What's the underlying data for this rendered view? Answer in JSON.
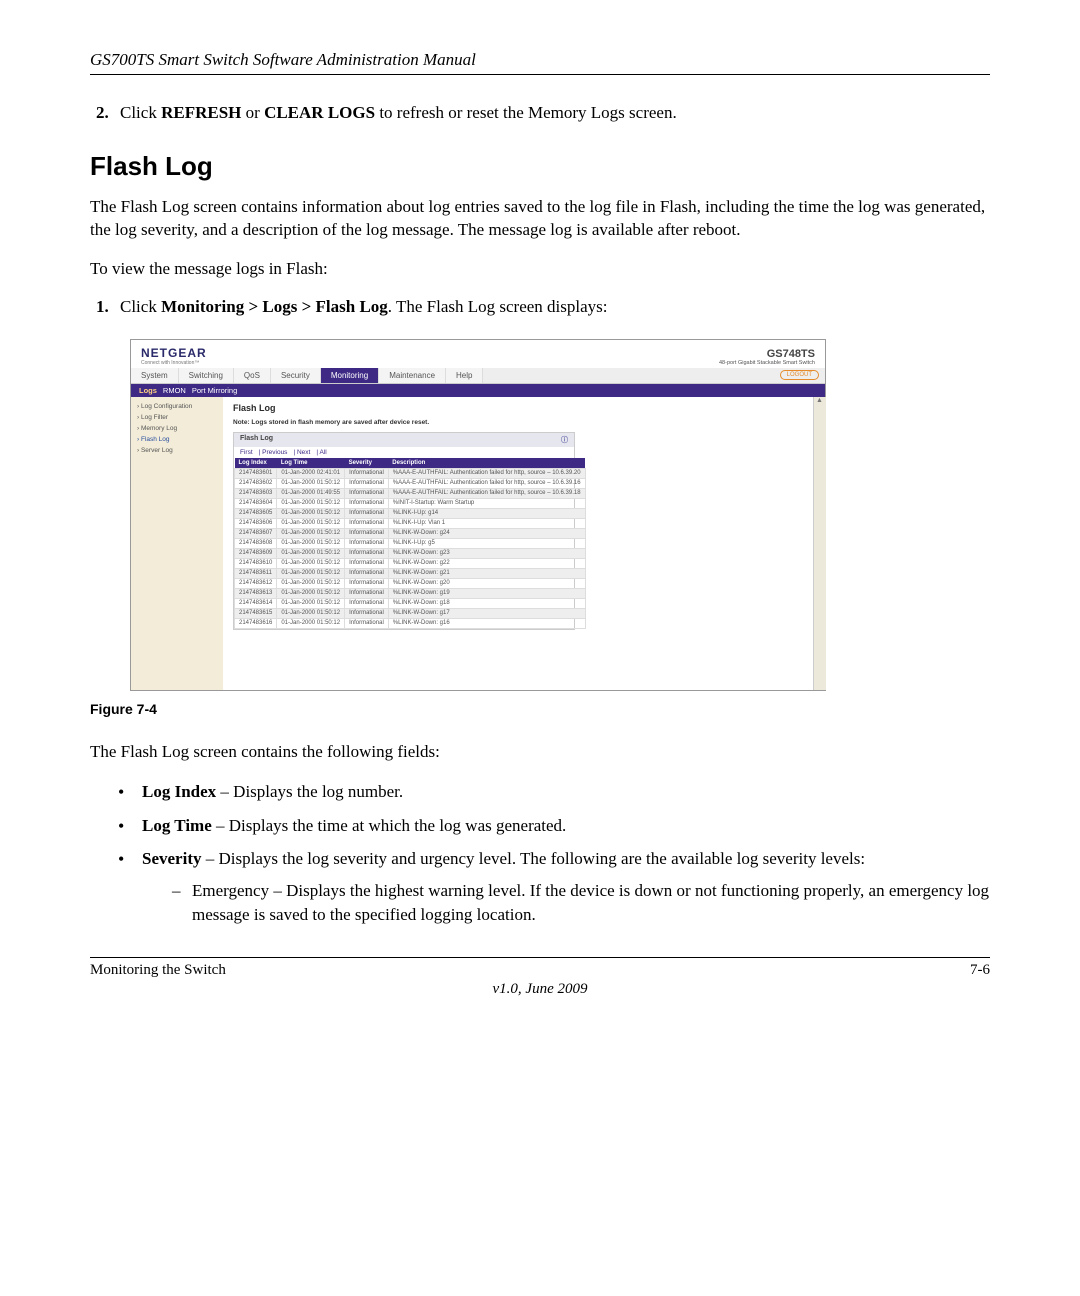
{
  "header_title": "GS700TS Smart Switch Software Administration Manual",
  "step2_num": "2.",
  "step2_html": "Click <b>REFRESH</b> or <b>CLEAR LOGS</b> to refresh or reset the Memory Logs screen.",
  "h2": "Flash Log",
  "intro": "The Flash Log screen contains information about log entries saved to the log file in Flash, including the time the log was generated, the log severity, and a description of the log message. The message log is available after reboot.",
  "lead": "To view the message logs in Flash:",
  "step1_num": "1.",
  "step1_html": "Click <b>Monitoring > Logs > Flash Log</b>. The Flash Log screen displays:",
  "fig_caption": "Figure 7-4",
  "after_fig": "The Flash Log screen contains the following fields:",
  "bullets": [
    {
      "term": "Log Index",
      "desc": " – Displays the log number."
    },
    {
      "term": "Log Time",
      "desc": " – Displays the time at which the log was generated."
    },
    {
      "term": "Severity",
      "desc": " – Displays the log severity and urgency level. The following are the available log severity levels:",
      "sub": [
        {
          "desc": "Emergency – Displays the highest warning level. If the device is down or not functioning properly, an emergency log message is saved to the specified logging location."
        }
      ]
    }
  ],
  "footer_left": "Monitoring the Switch",
  "footer_right": "7-6",
  "footer_ver": "v1.0, June 2009",
  "ss": {
    "brand": "NETGEAR",
    "brand_sub": "Connect with Innovation™",
    "model": "GS748TS",
    "model_sub": "48-port Gigabit Stackable Smart Switch",
    "tabs": [
      "System",
      "Switching",
      "QoS",
      "Security",
      "Monitoring",
      "Maintenance",
      "Help"
    ],
    "active_tab": "Monitoring",
    "logout": "LOGOUT",
    "subtabs": [
      "Logs",
      "RMON",
      "Port Mirroring"
    ],
    "subtab_active": "Logs",
    "side": [
      "Log Configuration",
      "Log Filter",
      "Memory Log",
      "Flash Log",
      "Server Log"
    ],
    "side_selected": "Flash Log",
    "panel_title": "Flash Log",
    "note": "Note: Logs stored in flash memory are saved after device reset.",
    "inner_title": "Flash Log",
    "pager": [
      "First",
      "Previous",
      "Next",
      "All"
    ],
    "cols": [
      "Log Index",
      "Log Time",
      "Severity",
      "Description"
    ],
    "rows": [
      [
        "2147483601",
        "01-Jan-2000 02:41:01",
        "Informational",
        "%AAA-E-AUTHFAIL: Authentication failed for http, source – 10.6.39.20"
      ],
      [
        "2147483602",
        "01-Jan-2000 01:50:12",
        "Informational",
        "%AAA-E-AUTHFAIL: Authentication failed for http, source – 10.6.39.16"
      ],
      [
        "2147483603",
        "01-Jan-2000 01:49:55",
        "Informational",
        "%AAA-E-AUTHFAIL: Authentication failed for http, source – 10.6.39.18"
      ],
      [
        "2147483604",
        "01-Jan-2000 01:50:12",
        "Informational",
        "%INIT-I-Startup: Warm Startup"
      ],
      [
        "2147483605",
        "01-Jan-2000 01:50:12",
        "Informational",
        "%LINK-I-Up: g14"
      ],
      [
        "2147483606",
        "01-Jan-2000 01:50:12",
        "Informational",
        "%LINK-I-Up: Vlan 1"
      ],
      [
        "2147483607",
        "01-Jan-2000 01:50:12",
        "Informational",
        "%LINK-W-Down: g24"
      ],
      [
        "2147483608",
        "01-Jan-2000 01:50:12",
        "Informational",
        "%LINK-I-Up: g5"
      ],
      [
        "2147483609",
        "01-Jan-2000 01:50:12",
        "Informational",
        "%LINK-W-Down: g23"
      ],
      [
        "2147483610",
        "01-Jan-2000 01:50:12",
        "Informational",
        "%LINK-W-Down: g22"
      ],
      [
        "2147483611",
        "01-Jan-2000 01:50:12",
        "Informational",
        "%LINK-W-Down: g21"
      ],
      [
        "2147483612",
        "01-Jan-2000 01:50:12",
        "Informational",
        "%LINK-W-Down: g20"
      ],
      [
        "2147483613",
        "01-Jan-2000 01:50:12",
        "Informational",
        "%LINK-W-Down: g19"
      ],
      [
        "2147483614",
        "01-Jan-2000 01:50:12",
        "Informational",
        "%LINK-W-Down: g18"
      ],
      [
        "2147483615",
        "01-Jan-2000 01:50:12",
        "Informational",
        "%LINK-W-Down: g17"
      ],
      [
        "2147483616",
        "01-Jan-2000 01:50:12",
        "Informational",
        "%LINK-W-Down: g16"
      ]
    ]
  }
}
